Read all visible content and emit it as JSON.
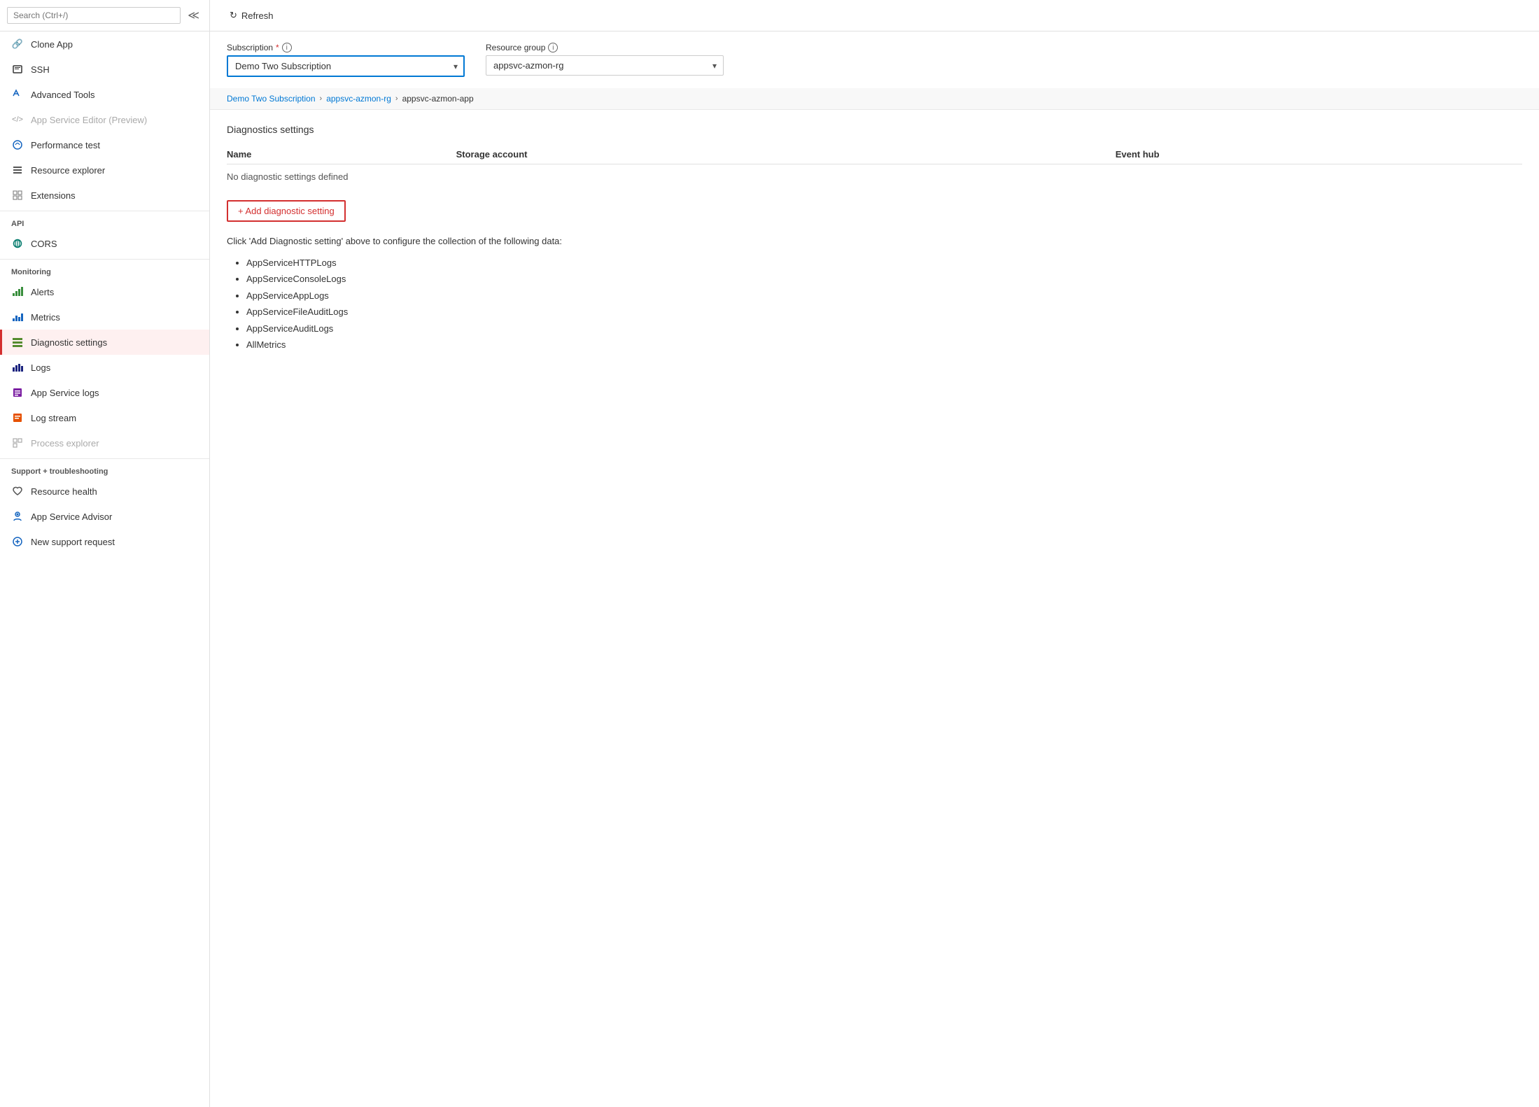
{
  "sidebar": {
    "search_placeholder": "Search (Ctrl+/)",
    "items": [
      {
        "id": "clone-app",
        "label": "Clone App",
        "icon": "🔗",
        "icon_class": "icon-gray",
        "disabled": false,
        "active": false
      },
      {
        "id": "ssh",
        "label": "SSH",
        "icon": "▪",
        "icon_class": "icon-gray",
        "disabled": false,
        "active": false
      },
      {
        "id": "advanced-tools",
        "label": "Advanced Tools",
        "icon": "🔧",
        "icon_class": "icon-blue",
        "disabled": false,
        "active": false
      },
      {
        "id": "app-service-editor",
        "label": "App Service Editor (Preview)",
        "icon": "</>",
        "icon_class": "icon-gray",
        "disabled": true,
        "active": false
      },
      {
        "id": "performance-test",
        "label": "Performance test",
        "icon": "☁",
        "icon_class": "icon-blue",
        "disabled": false,
        "active": false
      },
      {
        "id": "resource-explorer",
        "label": "Resource explorer",
        "icon": "≡",
        "icon_class": "icon-gray",
        "disabled": false,
        "active": false
      },
      {
        "id": "extensions",
        "label": "Extensions",
        "icon": "⊞",
        "icon_class": "icon-gray",
        "disabled": false,
        "active": false
      }
    ],
    "sections": [
      {
        "label": "API",
        "items": [
          {
            "id": "cors",
            "label": "CORS",
            "icon": "⊕",
            "icon_class": "icon-teal",
            "disabled": false,
            "active": false
          }
        ]
      },
      {
        "label": "Monitoring",
        "items": [
          {
            "id": "alerts",
            "label": "Alerts",
            "icon": "📊",
            "icon_class": "icon-green",
            "disabled": false,
            "active": false
          },
          {
            "id": "metrics",
            "label": "Metrics",
            "icon": "📈",
            "icon_class": "icon-blue",
            "disabled": false,
            "active": false
          },
          {
            "id": "diagnostic-settings",
            "label": "Diagnostic settings",
            "icon": "📋",
            "icon_class": "icon-lime",
            "disabled": false,
            "active": true
          },
          {
            "id": "logs",
            "label": "Logs",
            "icon": "📊",
            "icon_class": "icon-darkblue",
            "disabled": false,
            "active": false
          },
          {
            "id": "app-service-logs",
            "label": "App Service logs",
            "icon": "📋",
            "icon_class": "icon-purple",
            "disabled": false,
            "active": false
          },
          {
            "id": "log-stream",
            "label": "Log stream",
            "icon": "⊡",
            "icon_class": "icon-orange",
            "disabled": false,
            "active": false
          },
          {
            "id": "process-explorer",
            "label": "Process explorer",
            "icon": "⊞",
            "icon_class": "icon-gray",
            "disabled": true,
            "active": false
          }
        ]
      },
      {
        "label": "Support + troubleshooting",
        "items": [
          {
            "id": "resource-health",
            "label": "Resource health",
            "icon": "♡",
            "icon_class": "icon-gray",
            "disabled": false,
            "active": false
          },
          {
            "id": "app-service-advisor",
            "label": "App Service Advisor",
            "icon": "🎖",
            "icon_class": "icon-blue",
            "disabled": false,
            "active": false
          },
          {
            "id": "new-support-request",
            "label": "New support request",
            "icon": "⊕",
            "icon_class": "icon-blue",
            "disabled": false,
            "active": false
          }
        ]
      }
    ]
  },
  "toolbar": {
    "refresh_label": "Refresh",
    "refresh_icon": "↻"
  },
  "form": {
    "subscription_label": "Subscription",
    "subscription_required": "*",
    "subscription_value": "Demo Two Subscription",
    "subscription_options": [
      "Demo Two Subscription"
    ],
    "resource_group_label": "Resource group",
    "resource_group_value": "appsvc-azmon-rg",
    "resource_group_options": [
      "appsvc-azmon-rg"
    ]
  },
  "breadcrumb": {
    "items": [
      {
        "label": "Demo Two Subscription",
        "link": true
      },
      {
        "label": "appsvc-azmon-rg",
        "link": true
      },
      {
        "label": "appsvc-azmon-app",
        "link": false
      }
    ],
    "separator": "›"
  },
  "diagnostics": {
    "section_title": "Diagnostics settings",
    "columns": [
      "Name",
      "Storage account",
      "Event hub"
    ],
    "empty_message": "No diagnostic settings defined",
    "add_button_label": "+ Add diagnostic setting",
    "instructions": "Click 'Add Diagnostic setting' above to configure the collection of the following data:",
    "data_types": [
      "AppServiceHTTPLogs",
      "AppServiceConsoleLogs",
      "AppServiceAppLogs",
      "AppServiceFileAuditLogs",
      "AppServiceAuditLogs",
      "AllMetrics"
    ]
  }
}
